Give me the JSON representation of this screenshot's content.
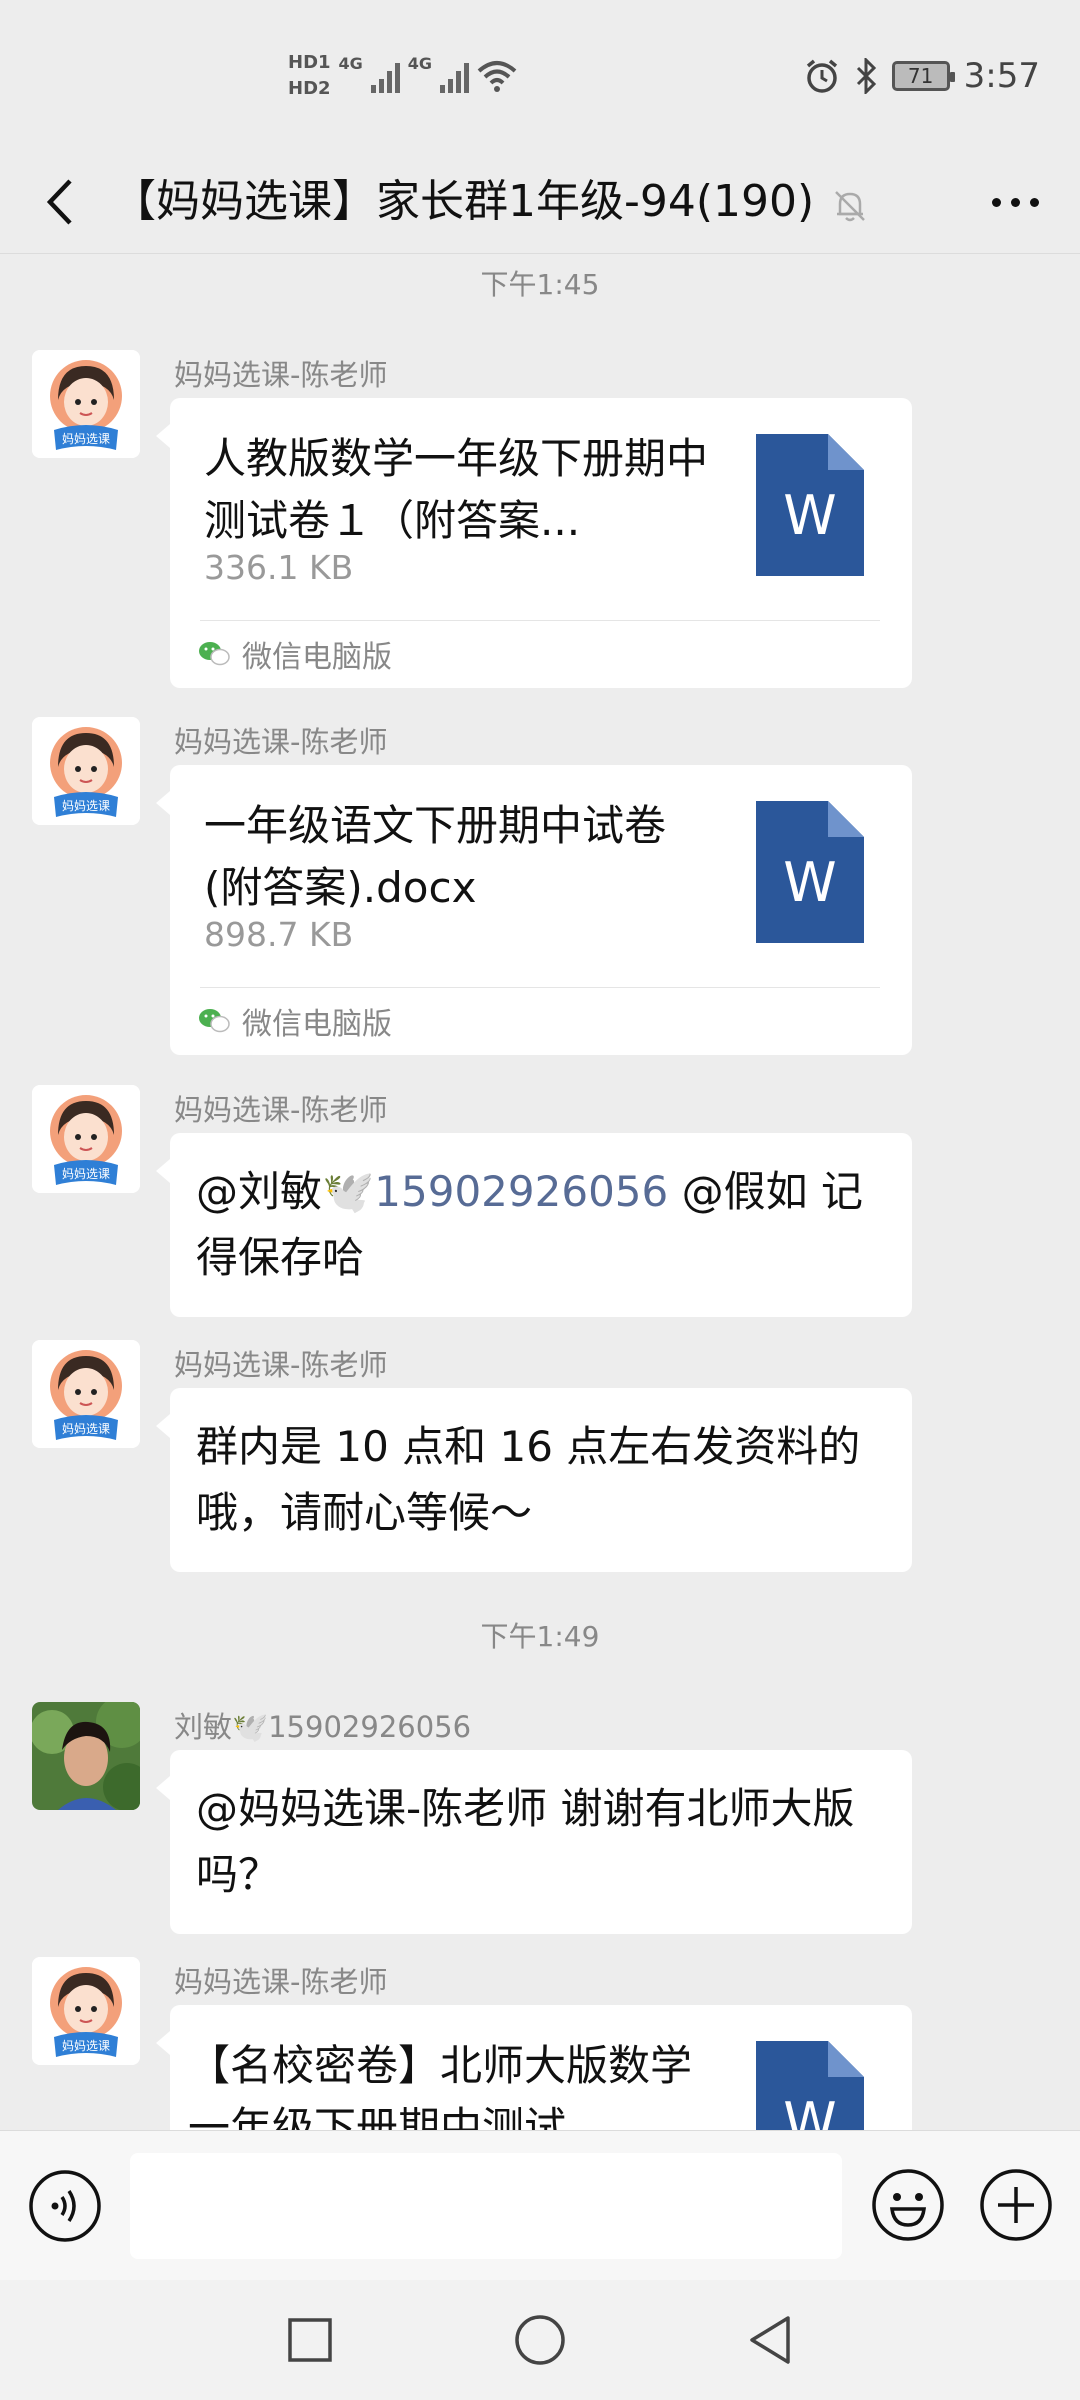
{
  "status_bar": {
    "hd1": "HD1",
    "hd2": "HD2",
    "net1": "4G",
    "net2": "4G",
    "battery": "71",
    "time": "3:57"
  },
  "header": {
    "title": "【妈妈选课】家长群1年级-94(190)"
  },
  "messages": [
    {
      "type": "timestamp",
      "text": "下午1:45"
    },
    {
      "type": "file",
      "sender": "妈妈选课-陈老师",
      "file_name": "人教版数学一年级下册期中测试卷１（附答案...",
      "file_size": "336.1 KB",
      "icon_label": "W",
      "source": "微信电脑版"
    },
    {
      "type": "file",
      "sender": "妈妈选课-陈老师",
      "file_name": "一年级语文下册期中试卷(附答案).docx",
      "file_size": "898.7 KB",
      "icon_label": "W",
      "source": "微信电脑版"
    },
    {
      "type": "text",
      "sender": "妈妈选课-陈老师",
      "mention1": "@刘敏🕊️",
      "phone": "15902926056",
      "rest": " @假如 记得保存哈"
    },
    {
      "type": "text",
      "sender": "妈妈选课-陈老师",
      "text": "群内是 10 点和 16 点左右发资料的哦，请耐心等候～"
    },
    {
      "type": "timestamp",
      "text": "下午1:49"
    },
    {
      "type": "text",
      "sender": "刘敏🕊️15902926056",
      "text": "@妈妈选课-陈老师  谢谢有北师大版吗？"
    },
    {
      "type": "file",
      "sender": "妈妈选课-陈老师",
      "file_name": "【名校密卷】北师大版数学一年级下册期中测试",
      "icon_label": "W"
    }
  ],
  "avatar_label": "妈妈选课",
  "colors": {
    "background": "#ededed",
    "bubble": "#ffffff",
    "link": "#576b95",
    "word_blue": "#2b579a"
  }
}
